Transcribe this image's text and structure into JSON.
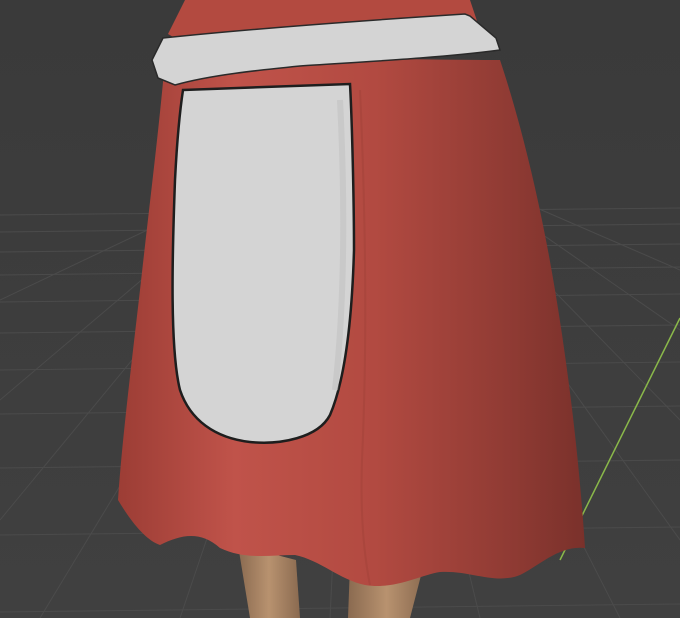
{
  "viewport": {
    "background_color": "#3d3d3d",
    "grid_line_color": "#4a4a4a",
    "axis_y_color": "#8ab84a"
  },
  "model": {
    "dress_color": "#b34a40",
    "dress_shadow_color": "#8c3a33",
    "dress_highlight_color": "#c85a4d",
    "apron_color": "#d4d4d4",
    "apron_edge_color": "#2a2a2a",
    "leg_color": "#b08a6a",
    "leg_shadow_color": "#8a6a50"
  }
}
